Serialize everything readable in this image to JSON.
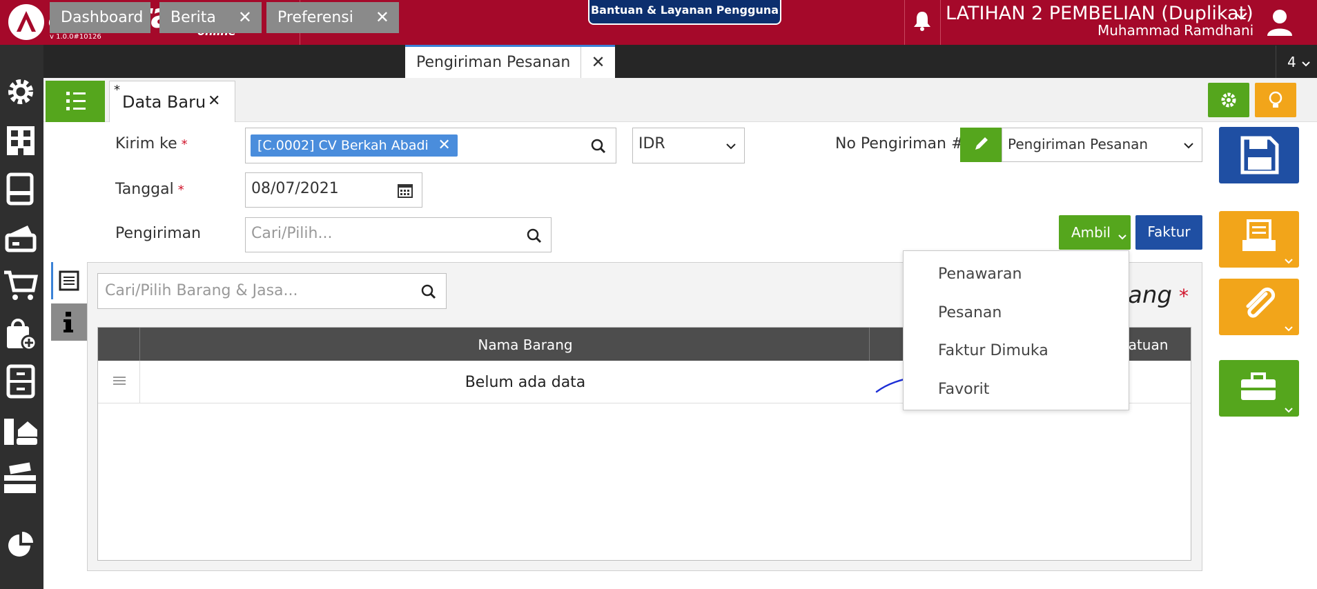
{
  "header": {
    "logo_text": "accurate",
    "logo_sub": "online",
    "version": "v 1.0.0#10126",
    "help_label": "Bantuan & Layanan Pengguna",
    "company": "LATIHAN 2 PEMBELIAN (Duplikat)",
    "user": "Muhammad Ramdhani"
  },
  "tabs": [
    {
      "label": "Dashboard"
    },
    {
      "label": "Berita"
    },
    {
      "label": "Preferensi"
    },
    {
      "label": "Pengiriman Pesanan"
    }
  ],
  "tab_count": "4",
  "subtab": {
    "star": "*",
    "label": "Data Baru"
  },
  "form": {
    "kirim_ke_label": "Kirim ke",
    "required_mark": "*",
    "kirim_ke_value": "[C.0002] CV Berkah Abadi",
    "currency": "IDR",
    "no_pengiriman_label": "No Pengiriman #",
    "no_pengiriman_type": "Pengiriman Pesanan",
    "tanggal_label": "Tanggal",
    "tanggal_value": "08/07/2021",
    "pengiriman_label": "Pengiriman",
    "pengiriman_placeholder": "Cari/Pilih..."
  },
  "buttons": {
    "ambil": "Ambil",
    "faktur": "Faktur"
  },
  "items": {
    "search_placeholder": "Cari/Pilih Barang & Jasa...",
    "columns": [
      "Nama Barang",
      "Satuan"
    ],
    "empty_text": "Belum ada data",
    "section_label": "rang",
    "section_mark": "*"
  },
  "ambil_menu": [
    "Penawaran",
    "Pesanan",
    "Faktur Dimuka",
    "Favorit"
  ],
  "colors": {
    "topbar": "#a5092a",
    "green": "#55a61d",
    "orange": "#f2a51a",
    "blue": "#1f4fa3",
    "chip": "#4a8ddc"
  }
}
